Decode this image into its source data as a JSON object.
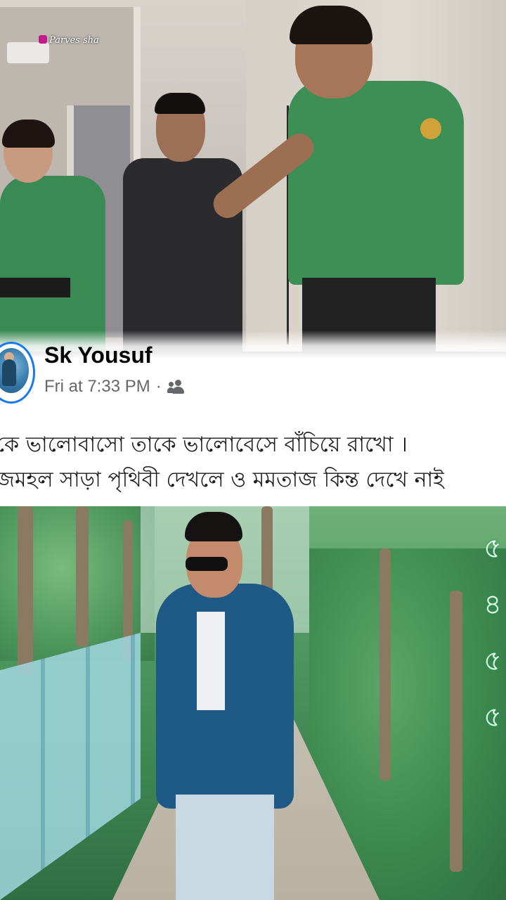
{
  "watermark": "Parves sha",
  "post": {
    "author": "Sk Yousuf",
    "timestamp": "Fri at 7:33 PM",
    "separator": "·",
    "audience_icon": "friends-icon",
    "text_lines": [
      "কে ভালোবাসো তাকে ভালোবেসে বাঁচিয়ে রাখো ।",
      "জমহল সাড়া পৃথিবী দেখলে ও মমতাজ কিন্ত দেখে নাই"
    ]
  },
  "colors": {
    "avatar_ring": "#1877f2",
    "author_text": "#050505",
    "meta_text": "#65676b",
    "card_bg": "#ffffff"
  }
}
